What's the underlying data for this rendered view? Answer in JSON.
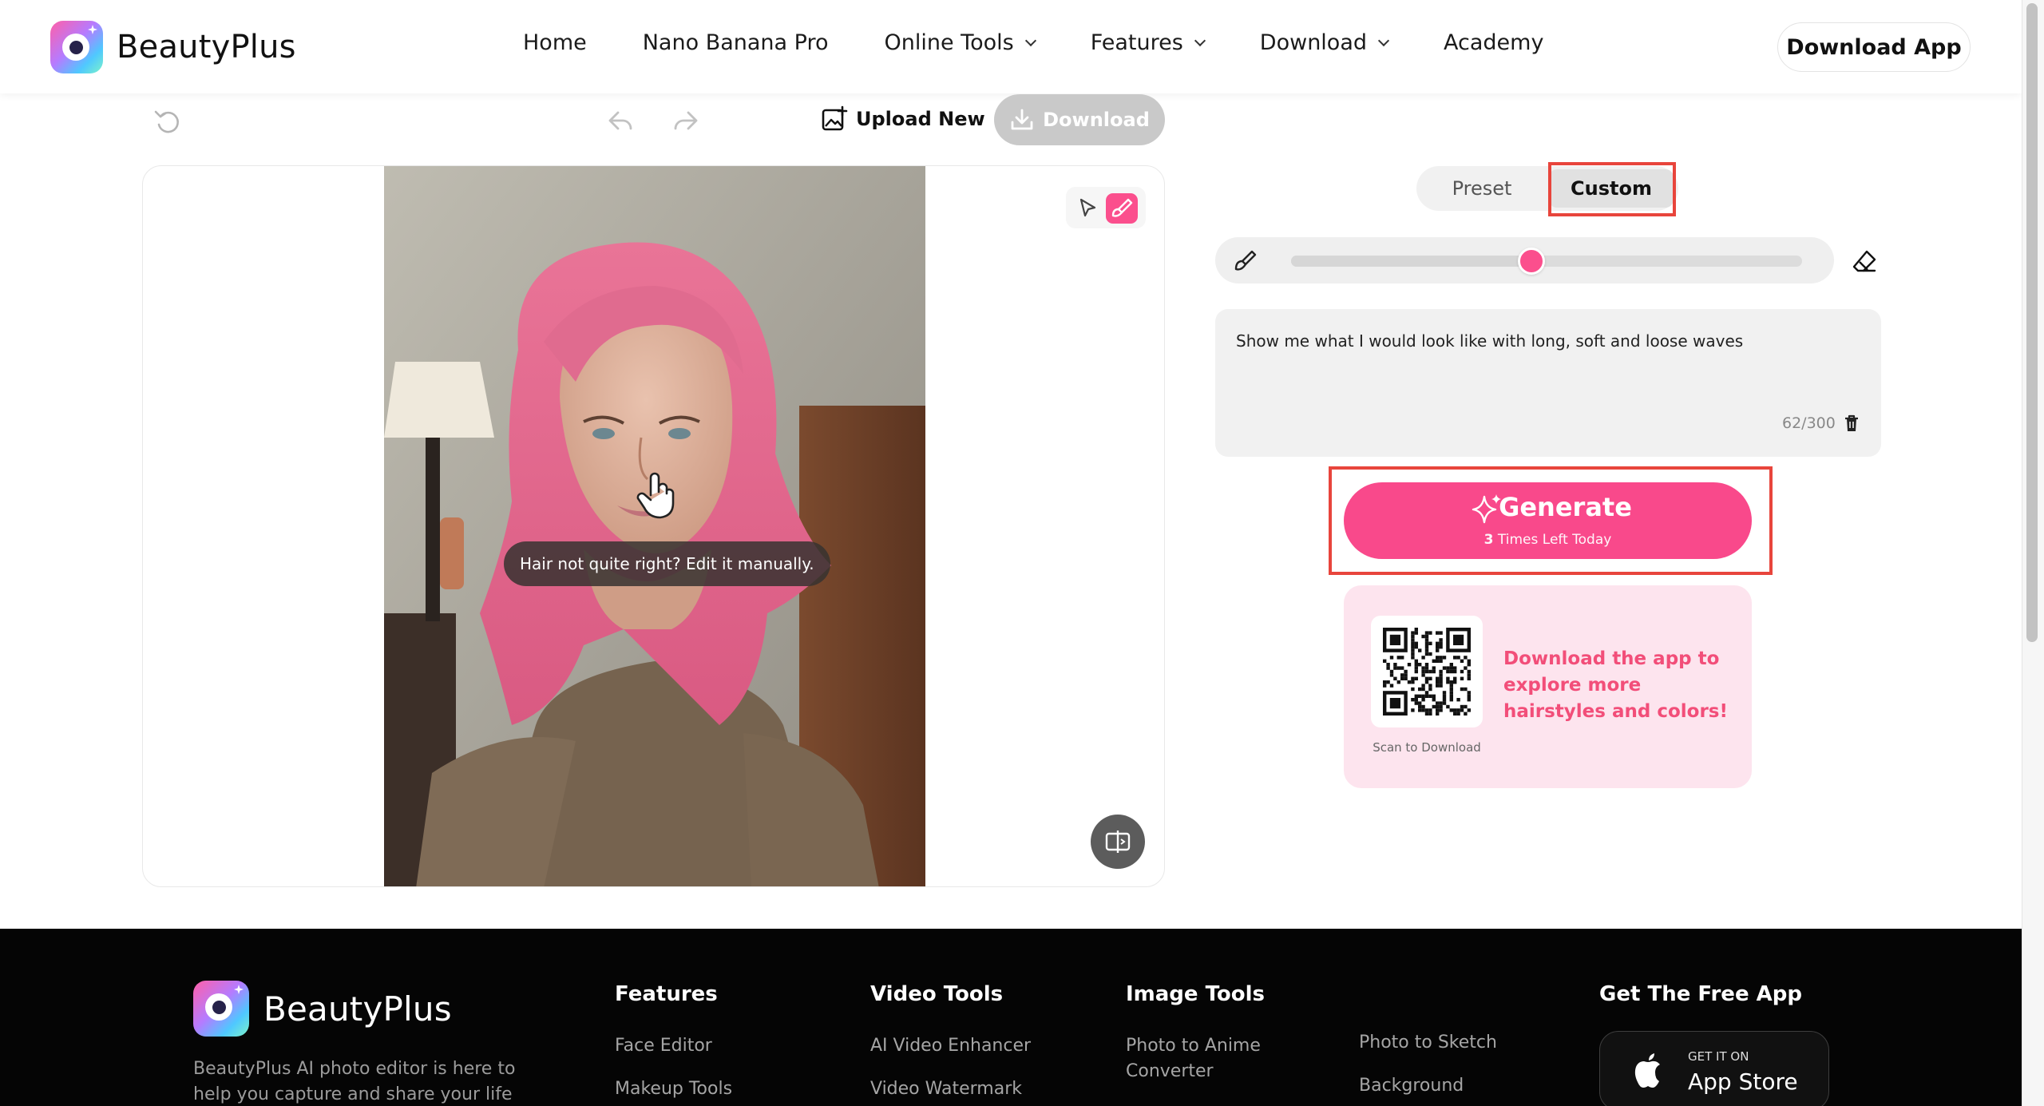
{
  "header": {
    "brand": "BeautyPlus",
    "nav": [
      {
        "label": "Home",
        "has_dropdown": false
      },
      {
        "label": "Nano Banana Pro",
        "has_dropdown": false
      },
      {
        "label": "Online Tools",
        "has_dropdown": true
      },
      {
        "label": "Features",
        "has_dropdown": true
      },
      {
        "label": "Download",
        "has_dropdown": true
      },
      {
        "label": "Academy",
        "has_dropdown": false
      }
    ],
    "download_app_label": "Download App"
  },
  "toolbar": {
    "upload_new_label": "Upload New",
    "download_label": "Download"
  },
  "canvas": {
    "tip": "Hair not quite right? Edit it manually."
  },
  "editor": {
    "tabs": [
      "Preset",
      "Custom"
    ],
    "active_tab": "Custom",
    "brush_size_fraction": 0.47,
    "prompt_text": "Show me what I would look like with long, soft and loose waves",
    "prompt_count": "62/300",
    "generate_label": "Generate",
    "generate_sub_count": "3",
    "generate_sub_text": "Times Left Today",
    "promo_text": "Download the app to explore more hairstyles and colors!",
    "qr_label": "Scan to Download"
  },
  "footer": {
    "brand": "BeautyPlus",
    "description": "BeautyPlus AI photo editor is here to help you capture and share your life",
    "columns": [
      {
        "heading": "Features",
        "links": [
          "Face Editor",
          "Makeup Tools"
        ]
      },
      {
        "heading": "Video Tools",
        "links": [
          "AI Video Enhancer",
          "Video Watermark"
        ]
      },
      {
        "heading": "Image Tools",
        "links": [
          "Photo to Anime Converter"
        ]
      },
      {
        "heading": "",
        "links": [
          "Photo to Sketch",
          "Background"
        ]
      }
    ],
    "app_heading": "Get The Free App",
    "appstore_small": "GET IT ON",
    "appstore_big": "App Store"
  },
  "colors": {
    "accent": "#f9498b",
    "highlight": "#e8453c",
    "promo_bg": "#fde4ee"
  }
}
